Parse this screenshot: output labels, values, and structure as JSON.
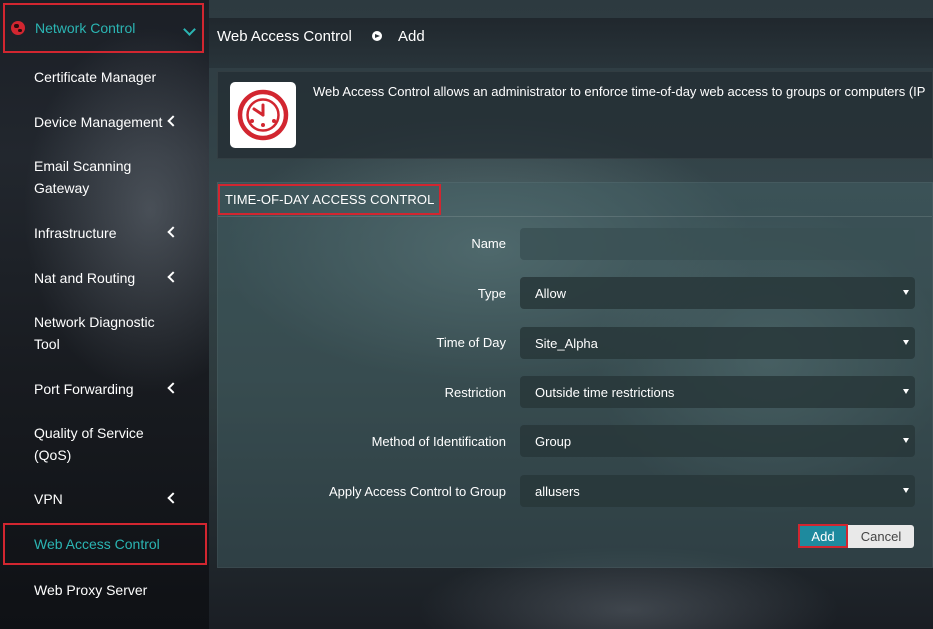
{
  "sidebar": {
    "section": "Network Control",
    "items": [
      {
        "label": "Certificate Manager"
      },
      {
        "label": "Device Management"
      },
      {
        "label": "Email Scanning Gateway"
      },
      {
        "label": "Infrastructure"
      },
      {
        "label": "Nat and Routing"
      },
      {
        "label": "Network Diagnostic Tool"
      },
      {
        "label": "Port Forwarding"
      },
      {
        "label": "Quality of Service (QoS)"
      },
      {
        "label": "VPN"
      },
      {
        "label": "Web Access Control"
      },
      {
        "label": "Web Proxy Server"
      }
    ],
    "active_item": "Web Access Control"
  },
  "breadcrumb": {
    "parent": "Web Access Control",
    "current": "Add"
  },
  "info": {
    "text": "Web Access Control allows an administrator to enforce time-of-day web access to groups or computers (IP"
  },
  "form": {
    "title": "TIME-OF-DAY ACCESS CONTROL",
    "name_label": "Name",
    "name_value": "",
    "type_label": "Type",
    "type_value": "Allow",
    "time_label": "Time of Day",
    "time_value": "Site_Alpha",
    "restriction_label": "Restriction",
    "restriction_value": "Outside time restrictions",
    "method_label": "Method of Identification",
    "method_value": "Group",
    "group_label": "Apply Access Control to Group",
    "group_value": "allusers",
    "add_label": "Add",
    "cancel_label": "Cancel"
  },
  "colors": {
    "accent": "#2bb5b3",
    "highlight_border": "#d22630",
    "add_button": "#1e8a9e"
  },
  "icons": {
    "section": "globe-icon",
    "info": "clock-icon"
  }
}
